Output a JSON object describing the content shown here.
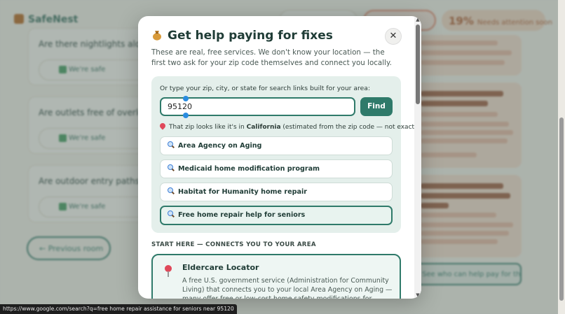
{
  "background": {
    "app_name": "SafeNest",
    "attention": {
      "count": "19%",
      "label": "Needs attention soon"
    },
    "questions": [
      {
        "text": "Are there nightlights alon",
        "safe_label": "We're safe"
      },
      {
        "text": "Are outlets free of overloa",
        "safe_label": "We're safe"
      },
      {
        "text": "Are outdoor entry paths a",
        "safe_label": "We're safe"
      }
    ],
    "prev_button": "← Previous room",
    "help_button": "See who can help pay for this"
  },
  "modal": {
    "title": "Get help paying for fixes",
    "title_icon": "money-bag-icon",
    "close_label": "✕",
    "subtitle": "These are real, free services. We don't know your location — the first two ask for your zip code themselves and connect you locally.",
    "search": {
      "label": "Or type your zip, city, or state for search links built for your area:",
      "value": "95120",
      "find_label": "Find",
      "note_prefix": "That zip looks like it's in ",
      "note_state": "California",
      "note_suffix": " (estimated from the zip code — not exact)."
    },
    "links": [
      {
        "label": "Area Agency on Aging",
        "active": false
      },
      {
        "label": "Medicaid home modification program",
        "active": false
      },
      {
        "label": "Habitat for Humanity home repair",
        "active": false
      },
      {
        "label": "Free home repair help for seniors",
        "active": true
      }
    ],
    "start_here": "START HERE — CONNECTS YOU TO YOUR AREA",
    "eldercare": {
      "title": "Eldercare Locator",
      "text": "A free U.S. government service (Administration for Community Living) that connects you to your local Area Agency on Aging — many offer free or low-cost home safety modifications for seniors."
    }
  },
  "status_url": "https://www.google.com/search?q=free home repair assistance for seniors near 95120",
  "colors": {
    "accent": "#2f7a6a",
    "panel": "#e4efeb",
    "pin": "#e0485a",
    "overlay": "#5f6c66"
  }
}
